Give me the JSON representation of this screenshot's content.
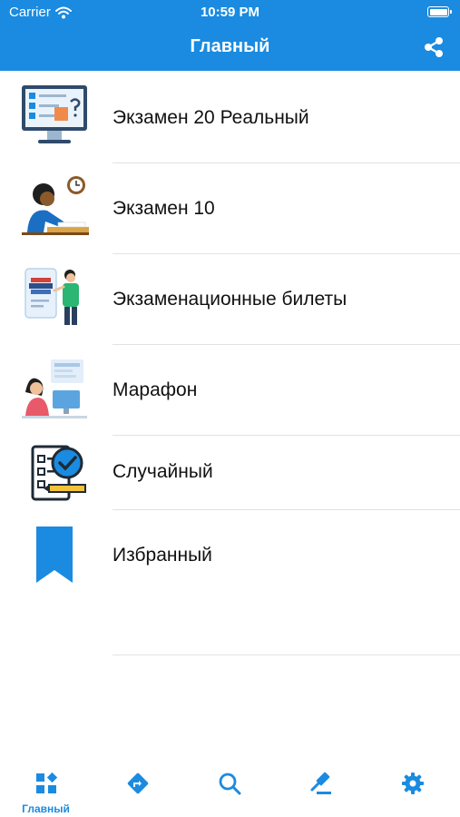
{
  "status_bar": {
    "carrier": "Carrier",
    "time": "10:59 PM"
  },
  "header": {
    "title": "Главный",
    "share_icon": "share-icon",
    "background": "#1a8be0"
  },
  "menu": {
    "items": [
      {
        "label": "Экзамен 20 Реальный",
        "icon": "exam-monitor-icon"
      },
      {
        "label": "Экзамен 10",
        "icon": "student-writing-icon"
      },
      {
        "label": "Экзаменационные билеты",
        "icon": "teacher-board-icon"
      },
      {
        "label": "Марафон",
        "icon": "student-computer-icon"
      },
      {
        "label": "Случайный",
        "icon": "checklist-icon"
      },
      {
        "label": "Избранный",
        "icon": "bookmark-icon"
      }
    ]
  },
  "tab_bar": {
    "accent": "#1a8be0",
    "tabs": [
      {
        "label": "Главный",
        "icon": "home-grid-icon",
        "selected": true
      },
      {
        "label": "",
        "icon": "directions-icon"
      },
      {
        "label": "",
        "icon": "search-icon"
      },
      {
        "label": "",
        "icon": "gavel-icon"
      },
      {
        "label": "",
        "icon": "gear-icon"
      }
    ]
  }
}
